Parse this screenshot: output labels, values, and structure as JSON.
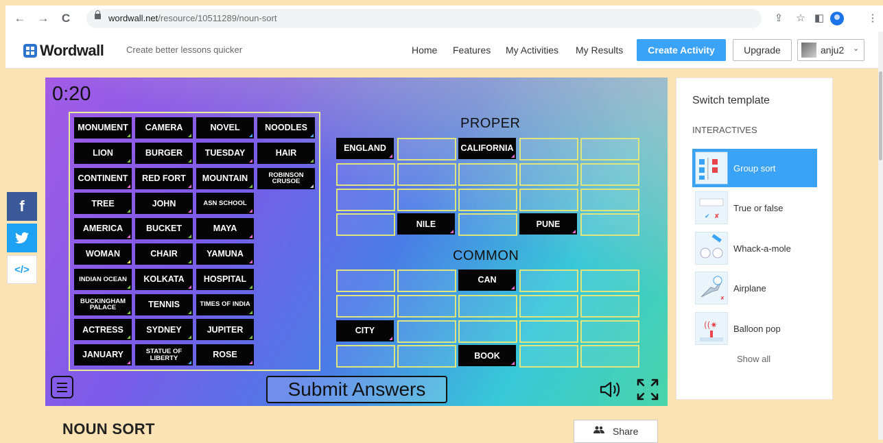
{
  "browser": {
    "back_icon": "←",
    "forward_icon": "→",
    "reload_icon": "C",
    "url_host": "wordwall.net",
    "url_path": "/resource/10511289/noun-sort",
    "share_icon": "⇪",
    "star_icon": "☆",
    "sidepanel_icon": "◧",
    "menu_icon": "⋮"
  },
  "header": {
    "logo": "Wordwall",
    "tagline": "Create better lessons quicker",
    "nav": [
      "Home",
      "Features",
      "My Activities",
      "My Results"
    ],
    "create_label": "Create Activity",
    "upgrade_label": "Upgrade",
    "user_name": "anju2",
    "user_caret": "⌄"
  },
  "social": {
    "facebook": "f",
    "twitter": "🐦",
    "embed": "</>"
  },
  "game": {
    "timer": "0:20",
    "pool": [
      [
        {
          "t": "MONUMENT",
          "c": "green"
        },
        {
          "t": "CAMERA",
          "c": "green"
        },
        {
          "t": "NOVEL",
          "c": "blue"
        },
        {
          "t": "NOODLES",
          "c": "blue"
        }
      ],
      [
        {
          "t": "LION",
          "c": "green"
        },
        {
          "t": "BURGER",
          "c": "green"
        },
        {
          "t": "TUESDAY",
          "c": "pink"
        },
        {
          "t": "HAIR",
          "c": "green"
        }
      ],
      [
        {
          "t": "CONTINENT",
          "c": "pink"
        },
        {
          "t": "RED FORT",
          "c": "pink"
        },
        {
          "t": "MOUNTAIN",
          "c": "green"
        },
        {
          "t": "ROBINSON CRUSOE",
          "c": "white",
          "small": true
        }
      ],
      [
        {
          "t": "TREE",
          "c": "green"
        },
        {
          "t": "JOHN",
          "c": "pink"
        },
        {
          "t": "ASN SCHOOL",
          "c": "pink",
          "small": true
        }
      ],
      [
        {
          "t": "AMERICA",
          "c": "pink"
        },
        {
          "t": "BUCKET",
          "c": "green"
        },
        {
          "t": "MAYA",
          "c": "pink"
        }
      ],
      [
        {
          "t": "WOMAN",
          "c": "yellow"
        },
        {
          "t": "CHAIR",
          "c": "green"
        },
        {
          "t": "YAMUNA",
          "c": "pink"
        }
      ],
      [
        {
          "t": "INDIAN OCEAN",
          "c": "green",
          "small": true
        },
        {
          "t": "KOLKATA",
          "c": "pink"
        },
        {
          "t": "HOSPITAL",
          "c": "green"
        }
      ],
      [
        {
          "t": "BUCKINGHAM PALACE",
          "c": "green",
          "small": true
        },
        {
          "t": "TENNIS",
          "c": "green"
        },
        {
          "t": "TIMES OF INDIA",
          "c": "green",
          "small": true
        }
      ],
      [
        {
          "t": "ACTRESS",
          "c": "green"
        },
        {
          "t": "SYDNEY",
          "c": "green"
        },
        {
          "t": "JUPITER",
          "c": "green"
        }
      ],
      [
        {
          "t": "JANUARY",
          "c": "pink"
        },
        {
          "t": "STATUE OF LIBERTY",
          "c": "blue",
          "small": true
        },
        {
          "t": "ROSE",
          "c": "pink"
        }
      ]
    ],
    "proper_title": "PROPER",
    "common_title": "COMMON",
    "proper_grid": [
      [
        "ENGLAND",
        "",
        "CALIFORNIA",
        "",
        ""
      ],
      [
        "",
        "",
        "",
        "",
        ""
      ],
      [
        "",
        "",
        "",
        "",
        ""
      ],
      [
        "",
        "NILE",
        "",
        "PUNE",
        ""
      ]
    ],
    "common_grid": [
      [
        "",
        "",
        "CAN",
        "",
        ""
      ],
      [
        "",
        "",
        "",
        "",
        ""
      ],
      [
        "CITY",
        "",
        "",
        "",
        ""
      ],
      [
        "",
        "",
        "BOOK",
        "",
        ""
      ]
    ],
    "submit_label": "Submit Answers",
    "sound_icon": "🔈",
    "fullscreen_icon": "⛶"
  },
  "panel": {
    "title": "Switch template",
    "subtitle": "INTERACTIVES",
    "templates": [
      "Group sort",
      "True or false",
      "Whack-a-mole",
      "Airplane",
      "Balloon pop"
    ],
    "show_all": "Show all"
  },
  "activity": {
    "title": "NOUN SORT",
    "share_label": "Share",
    "share_icon": "👥"
  },
  "colors": {
    "green": "#7fbf4d",
    "pink": "#e96ad0",
    "blue": "#49a4f0",
    "yellow": "#e8e86b",
    "white": "#cfcfcf",
    "accent": "#3aa3f5"
  }
}
